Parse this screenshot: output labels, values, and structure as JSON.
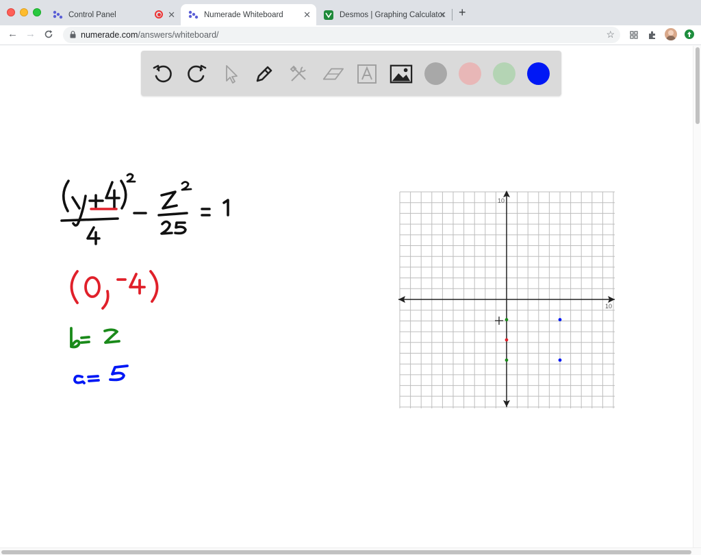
{
  "browser": {
    "tabs": [
      {
        "title": "Control Panel",
        "active": false,
        "recording": true
      },
      {
        "title": "Numerade Whiteboard",
        "active": true
      },
      {
        "title": "Desmos | Graphing Calculator",
        "active": false
      }
    ],
    "url_host": "numerade.com",
    "url_path": "/answers/whiteboard/"
  },
  "whiteboard": {
    "tools": [
      "undo-icon",
      "redo-icon",
      "select-pointer-icon",
      "pen-icon",
      "tools-icon",
      "eraser-icon",
      "text-icon",
      "image-icon"
    ],
    "colors": [
      {
        "name": "gray",
        "hex": "#a8a8a8"
      },
      {
        "name": "pink",
        "hex": "#e8b7b7"
      },
      {
        "name": "green",
        "hex": "#b4d4b4"
      },
      {
        "name": "blue",
        "hex": "#0018f5"
      }
    ],
    "active_color": "blue",
    "handwriting": {
      "equation": "(y+4)^2/4 - x^2/25 = 1",
      "center": "(0,-4)",
      "b_value": "b= 2",
      "a_value": "a= 5"
    },
    "grid": {
      "x_tick_label": "10",
      "y_tick_label": "10",
      "xlim": [
        -10,
        10
      ],
      "ylim": [
        -10,
        10
      ]
    },
    "points": [
      {
        "x": 0,
        "y": -2,
        "color": "#1a8a1a"
      },
      {
        "x": 0,
        "y": -4,
        "color": "#e0202a"
      },
      {
        "x": 0,
        "y": -6,
        "color": "#1a8a1a"
      },
      {
        "x": 5,
        "y": -2,
        "color": "#0018f5"
      },
      {
        "x": 5,
        "y": -6,
        "color": "#0018f5"
      }
    ]
  }
}
